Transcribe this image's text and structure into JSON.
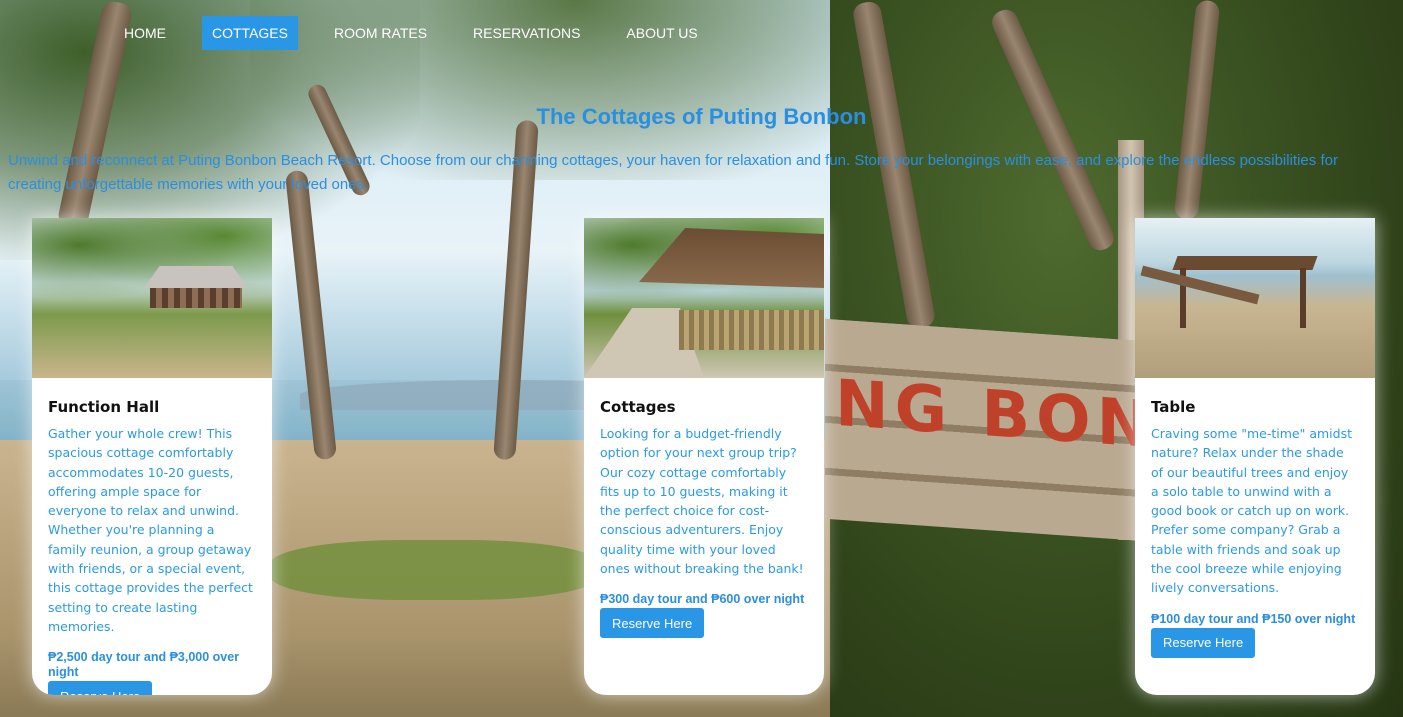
{
  "nav": {
    "items": [
      "HOME",
      "COTTAGES",
      "ROOM RATES",
      "RESERVATIONS",
      "ABOUT US"
    ],
    "active": "COTTAGES"
  },
  "page": {
    "title": "The Cottages of Puting Bonbon",
    "intro": "Unwind and reconnect at Puting Bonbon Beach Resort. Choose from our charming cottages, your haven for relaxation and fun. Store your belongings with ease, and explore the endless possibilities for creating unforgettable memories with your loved ones."
  },
  "background": {
    "sign_text": "NG BON BO"
  },
  "cards": [
    {
      "title": "Function Hall",
      "description": "Gather your whole crew! This spacious cottage comfortably accommodates 10-20 guests, offering ample space for everyone to relax and unwind. Whether you're planning a family reunion, a group getaway with friends, or a special event, this cottage provides the perfect setting to create lasting memories.",
      "price": "₱2,500 day tour and ₱3,000 over night",
      "button": "Reserve Here"
    },
    {
      "title": "Cottages",
      "description": "Looking for a budget-friendly option for your next group trip? Our cozy cottage comfortably fits up to 10 guests, making it the perfect choice for cost-conscious adventurers. Enjoy quality time with your loved ones without breaking the bank!",
      "price": "₱300 day tour and ₱600 over night",
      "button": "Reserve Here"
    },
    {
      "title": "Table",
      "description": "Craving some \"me-time\" amidst nature? Relax under the shade of our beautiful trees and enjoy a solo table to unwind with a good book or catch up on work. Prefer some company? Grab a table with friends and soak up the cool breeze while enjoying lively conversations.",
      "price": "₱100 day tour and ₱150 over night",
      "button": "Reserve Here"
    }
  ],
  "colors": {
    "accent": "#2a96e6",
    "text_blue": "#2a8fe0",
    "card_bg": "#ffffff"
  }
}
